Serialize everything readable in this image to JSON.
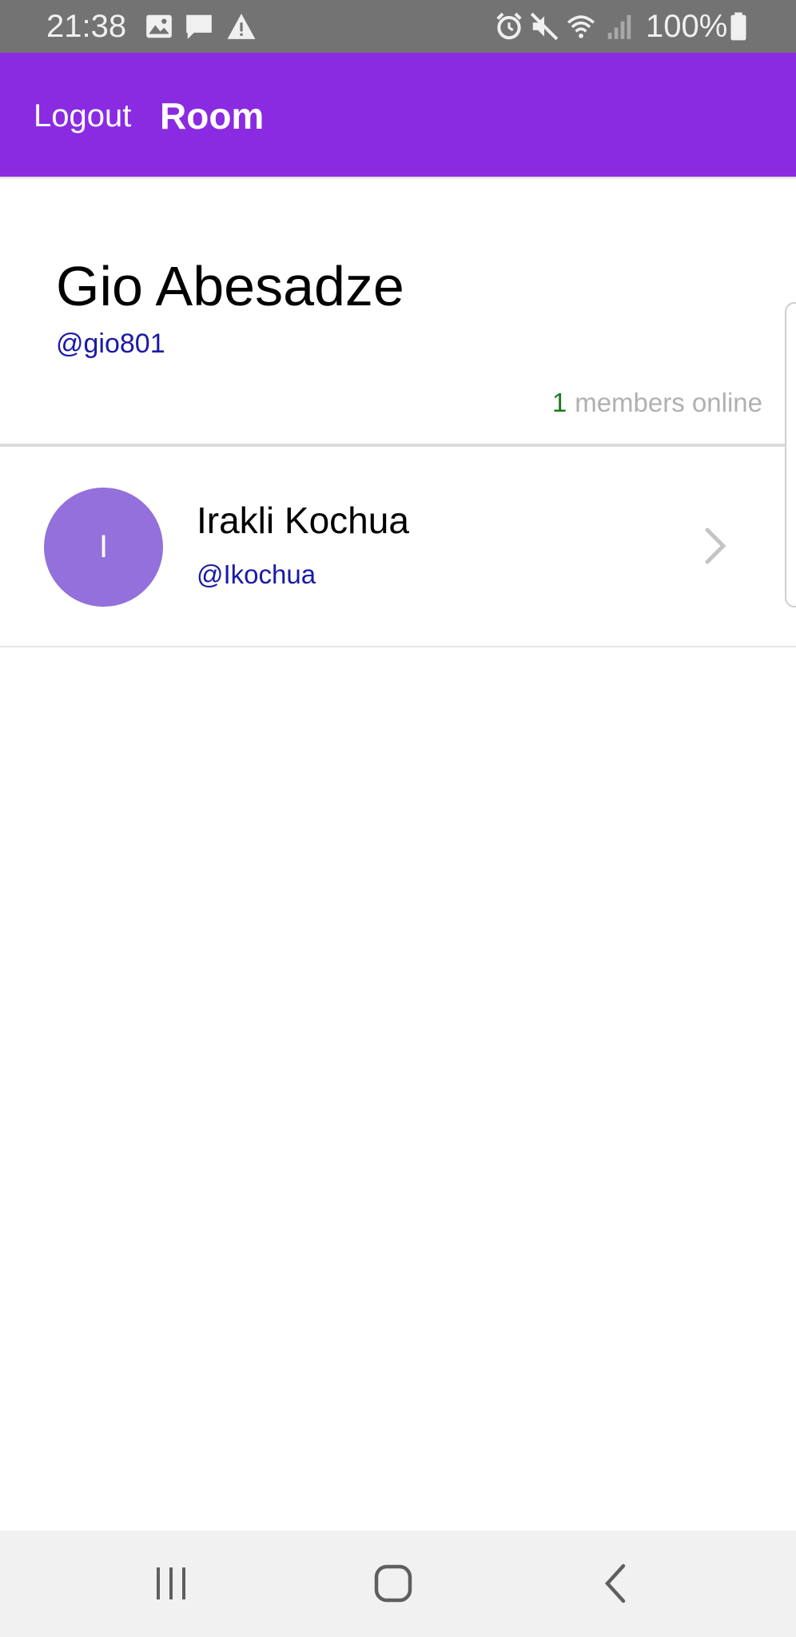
{
  "status_bar": {
    "time": "21:38",
    "battery_percent": "100%",
    "left_icons": [
      "image-icon",
      "message-icon",
      "warning-icon"
    ],
    "right_icons": [
      "alarm-icon",
      "mute-icon",
      "wifi-icon",
      "signal-icon",
      "battery-icon"
    ]
  },
  "app_bar": {
    "logout_label": "Logout",
    "title": "Room",
    "color": "#8a2be2"
  },
  "profile": {
    "name": "Gio Abesadze",
    "handle": "@gio801",
    "online_count": "1",
    "online_label": "members online"
  },
  "members": [
    {
      "avatar_initial": "I",
      "name": "Irakli Kochua",
      "handle": "@Ikochua",
      "avatar_color": "#9370db"
    }
  ],
  "nav_bar": {
    "buttons": [
      "recents-icon",
      "home-icon",
      "back-icon"
    ]
  }
}
